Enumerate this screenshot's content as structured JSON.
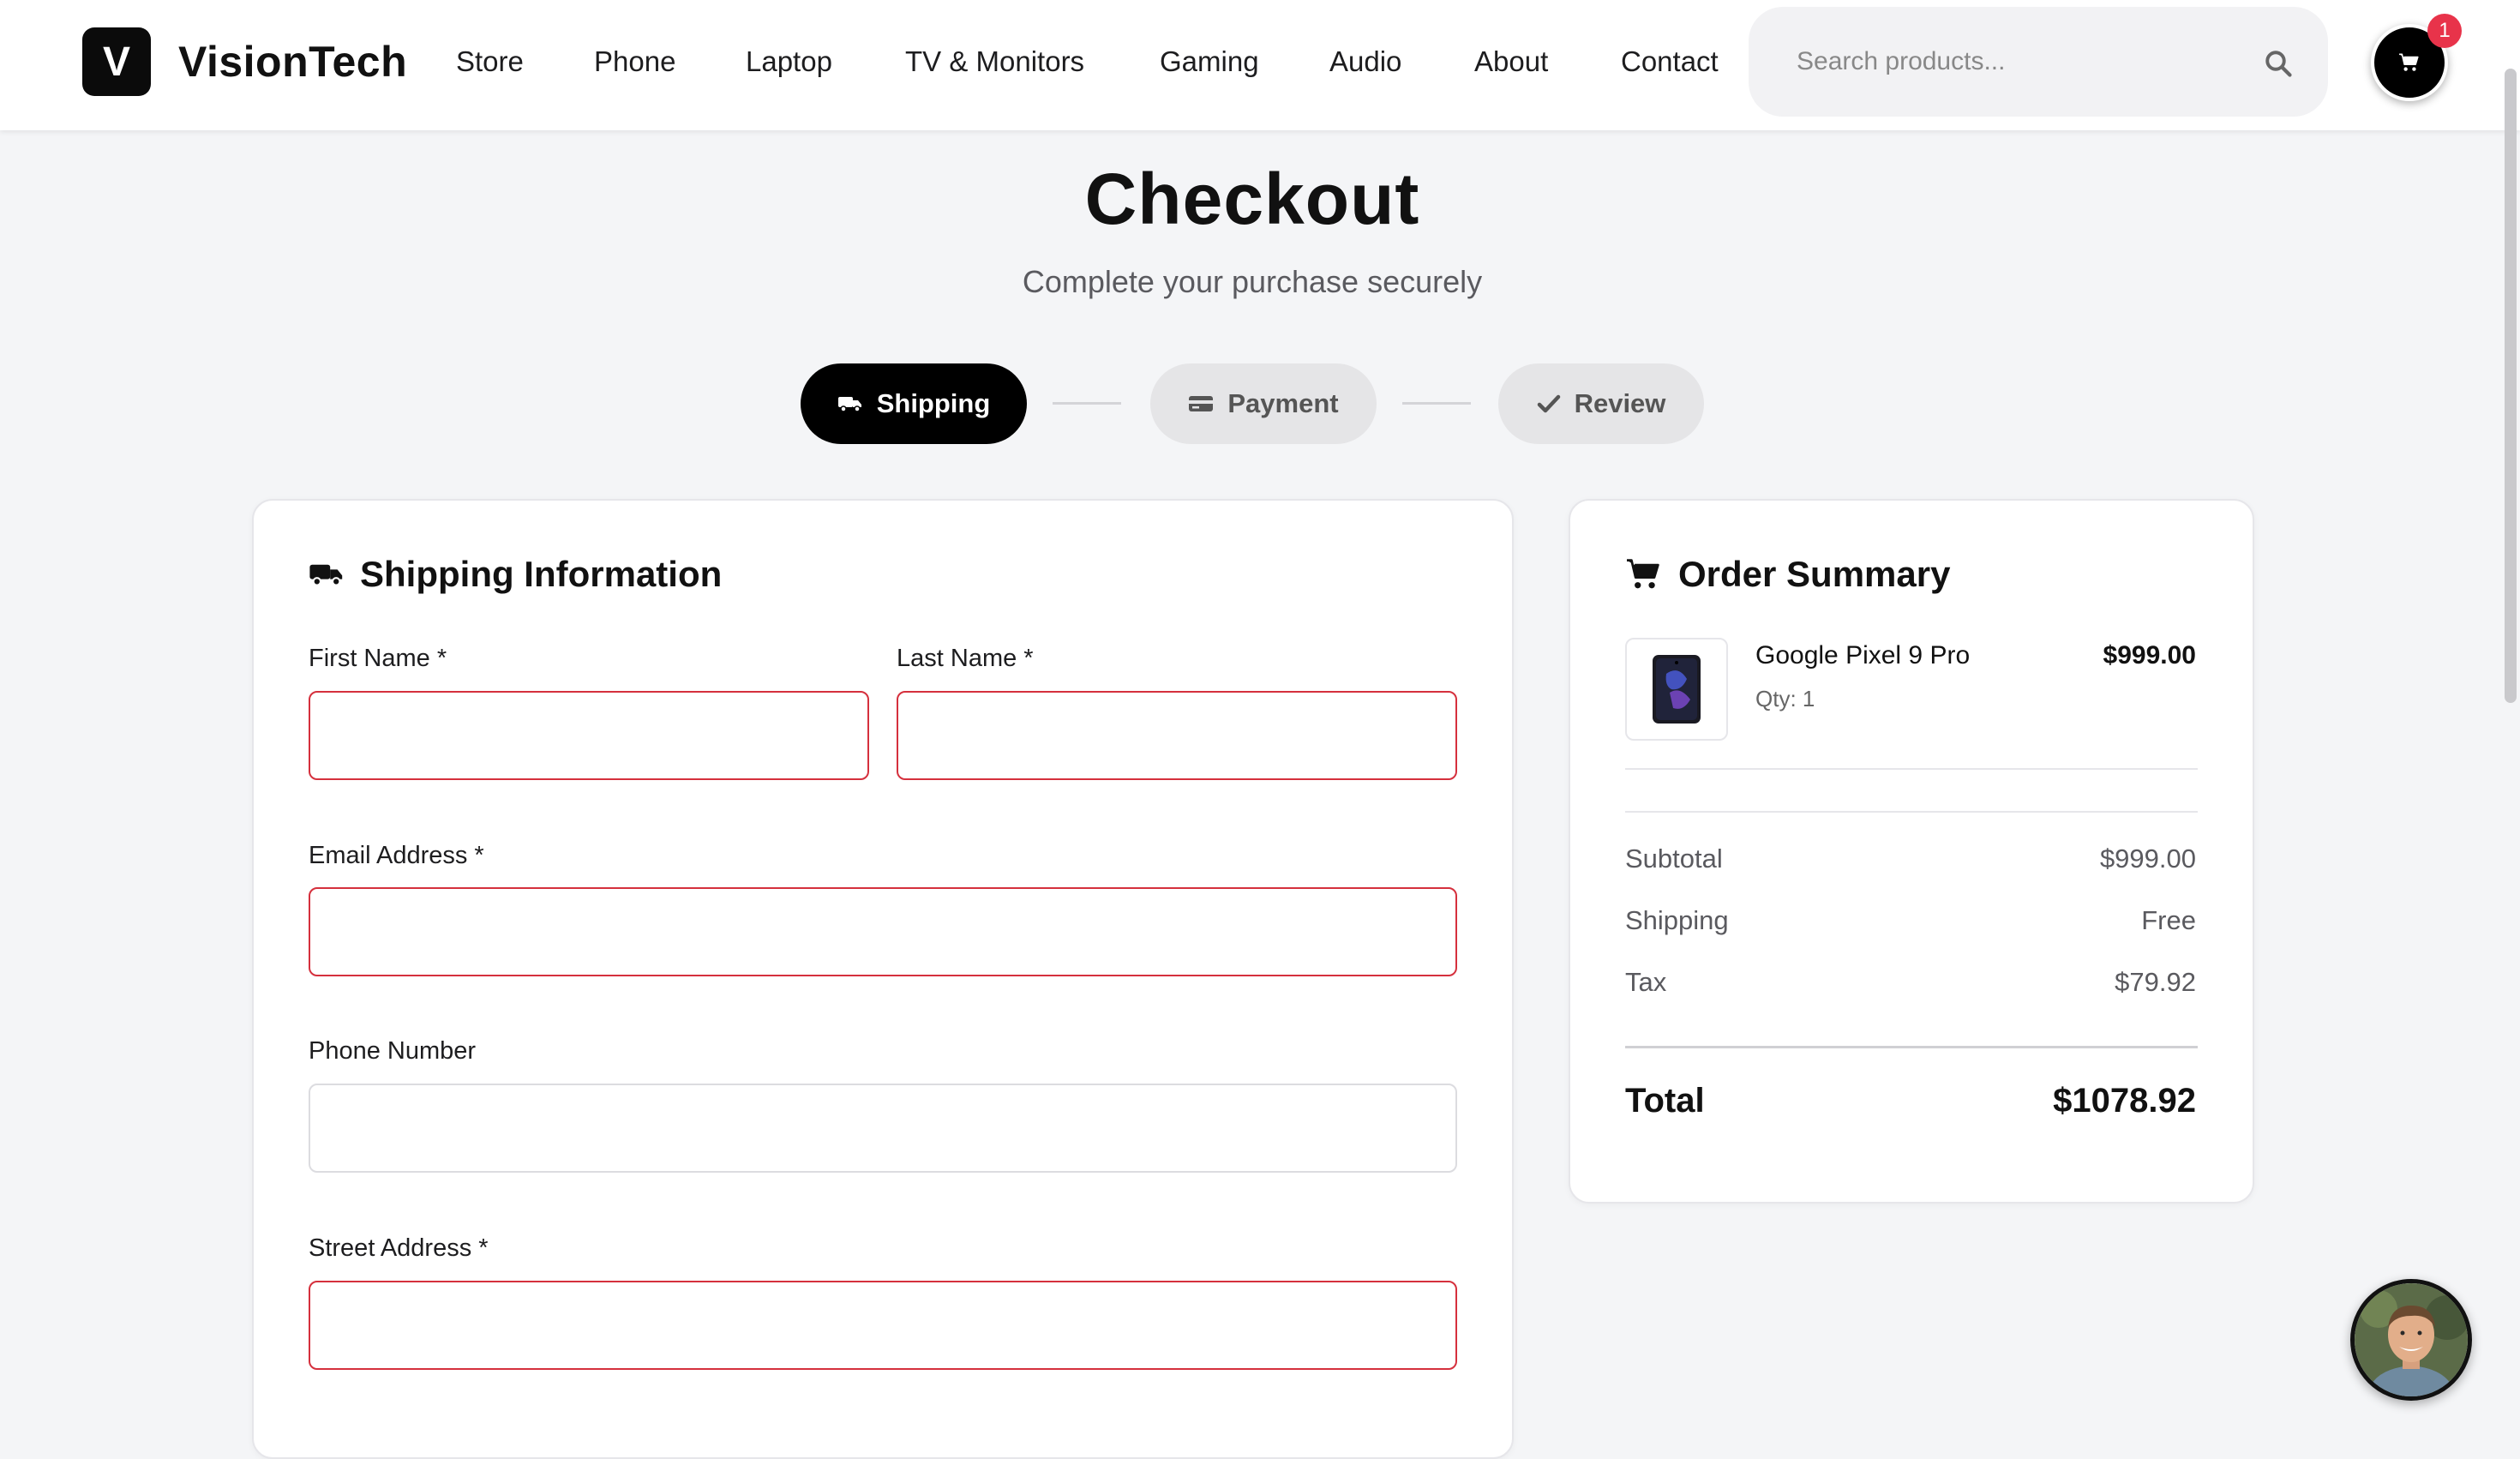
{
  "header": {
    "logo_letter": "V",
    "brand": "VisionTech",
    "nav": [
      "Store",
      "Phone",
      "Laptop",
      "TV & Monitors",
      "Gaming",
      "Audio",
      "About",
      "Contact"
    ],
    "search_placeholder": "Search products...",
    "cart_count": "1"
  },
  "page": {
    "title": "Checkout",
    "subtitle": "Complete your purchase securely"
  },
  "steps": [
    {
      "label": "Shipping",
      "icon": "truck-icon",
      "active": true
    },
    {
      "label": "Payment",
      "icon": "credit-card-icon",
      "active": false
    },
    {
      "label": "Review",
      "icon": "check-icon",
      "active": false
    }
  ],
  "shipping_form": {
    "title": "Shipping Information",
    "first_name_label": "First Name *",
    "last_name_label": "Last Name *",
    "email_label": "Email Address *",
    "phone_label": "Phone Number",
    "street_label": "Street Address *",
    "first_name_value": "",
    "last_name_value": "",
    "email_value": "",
    "phone_value": "",
    "street_value": ""
  },
  "order_summary": {
    "title": "Order Summary",
    "item_name": "Google Pixel 9 Pro",
    "item_qty": "Qty: 1",
    "item_price": "$999.00",
    "subtotal_label": "Subtotal",
    "subtotal_value": "$999.00",
    "shipping_label": "Shipping",
    "shipping_value": "Free",
    "tax_label": "Tax",
    "tax_value": "$79.92",
    "total_label": "Total",
    "total_value": "$1078.92"
  },
  "colors": {
    "accent": "#000000",
    "error_border": "#d5303d",
    "badge": "#e8334a",
    "background": "#f4f5f7"
  }
}
